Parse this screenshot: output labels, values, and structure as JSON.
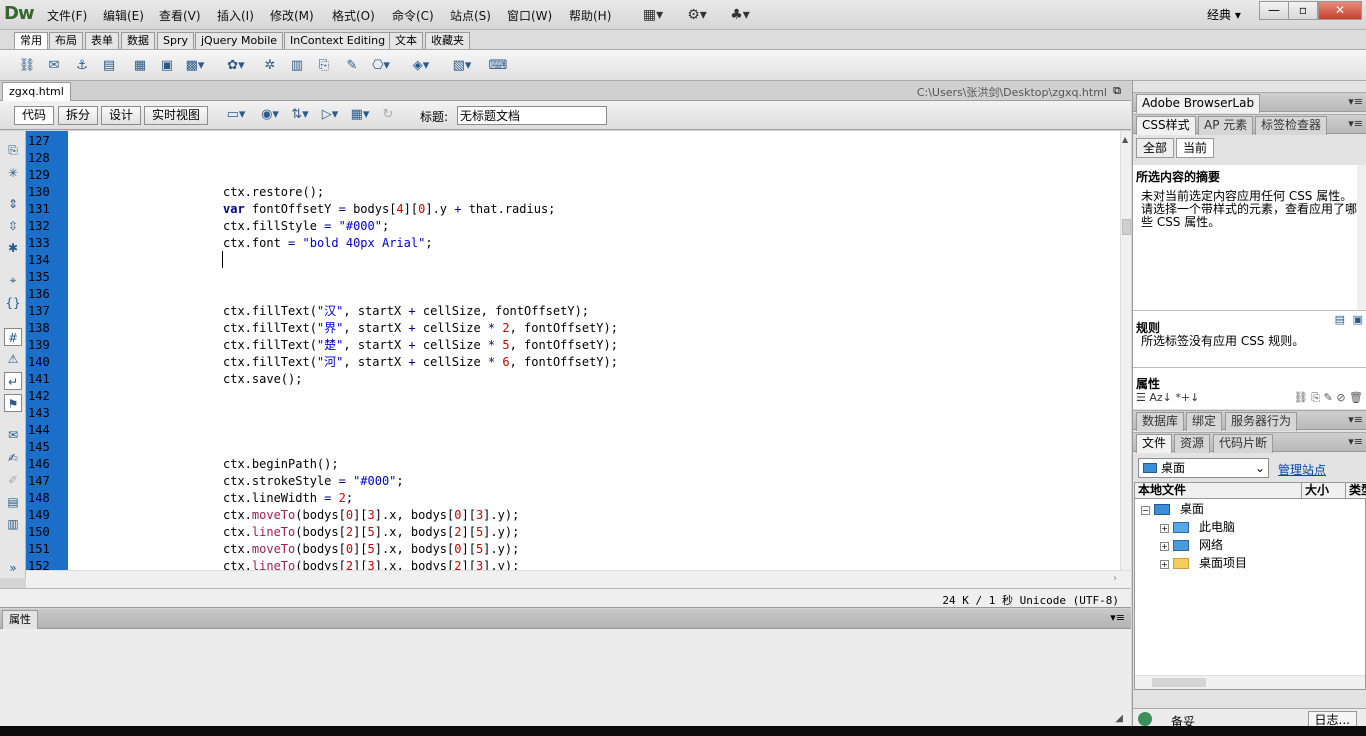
{
  "app": {
    "logo": "Dw"
  },
  "menu": [
    "文件(F)",
    "编辑(E)",
    "查看(V)",
    "插入(I)",
    "修改(M)",
    "格式(O)",
    "命令(C)",
    "站点(S)",
    "窗口(W)",
    "帮助(H)"
  ],
  "workspace": {
    "label": "经典",
    "arrow": "▾"
  },
  "window": {
    "min": "—",
    "max": "▫",
    "close": "✕"
  },
  "insert_tabs": [
    "常用",
    "布局",
    "表单",
    "数据",
    "Spry",
    "jQuery Mobile",
    "InContext Editing",
    "文本",
    "收藏夹"
  ],
  "document": {
    "filename": "zgxq.html",
    "path": "C:\\Users\\张洪剑\\Desktop\\zgxq.html",
    "view_buttons": [
      "代码",
      "拆分",
      "设计",
      "实时视图"
    ],
    "title_label": "标题:",
    "title_value": "无标题文档"
  },
  "code": {
    "lines": [
      {
        "n": "127",
        "t": ""
      },
      {
        "n": "128",
        "t": ""
      },
      {
        "n": "129",
        "t": ""
      },
      {
        "n": "130",
        "t": "ctx.restore();"
      },
      {
        "n": "131",
        "t": "var fontOffsetY = bodys[4][0].y + that.radius;"
      },
      {
        "n": "132",
        "t": "ctx.fillStyle = \"#000\";"
      },
      {
        "n": "133",
        "t": "ctx.font = \"bold 40px Arial\";"
      },
      {
        "n": "134",
        "t": ""
      },
      {
        "n": "135",
        "t": ""
      },
      {
        "n": "136",
        "t": ""
      },
      {
        "n": "137",
        "t": "ctx.fillText(\"汉\", startX + cellSize, fontOffsetY);"
      },
      {
        "n": "138",
        "t": "ctx.fillText(\"界\", startX + cellSize * 2, fontOffsetY);"
      },
      {
        "n": "139",
        "t": "ctx.fillText(\"楚\", startX + cellSize * 5, fontOffsetY);"
      },
      {
        "n": "140",
        "t": "ctx.fillText(\"河\", startX + cellSize * 6, fontOffsetY);"
      },
      {
        "n": "141",
        "t": "ctx.save();"
      },
      {
        "n": "142",
        "t": ""
      },
      {
        "n": "143",
        "t": ""
      },
      {
        "n": "144",
        "t": ""
      },
      {
        "n": "145",
        "t": ""
      },
      {
        "n": "146",
        "t": "ctx.beginPath();"
      },
      {
        "n": "147",
        "t": "ctx.strokeStyle = \"#000\";"
      },
      {
        "n": "148",
        "t": "ctx.lineWidth = 2;"
      },
      {
        "n": "149",
        "t": "ctx.moveTo(bodys[0][3].x, bodys[0][3].y);"
      },
      {
        "n": "150",
        "t": "ctx.lineTo(bodys[2][5].x, bodys[2][5].y);"
      },
      {
        "n": "151",
        "t": "ctx.moveTo(bodys[0][5].x, bodys[0][5].y);"
      },
      {
        "n": "152",
        "t": "ctx.lineTo(bodys[2][3].x, bodys[2][3].y);"
      }
    ]
  },
  "status": {
    "text": "24 K / 1 秒  Unicode (UTF-8)"
  },
  "properties_panel": {
    "tab": "属性"
  },
  "right": {
    "browserlab": "Adobe BrowserLab",
    "css_tabs": [
      "CSS样式",
      "AP 元素",
      "标签检查器"
    ],
    "css_modes": [
      "全部",
      "当前"
    ],
    "summary_title": "所选内容的摘要",
    "summary_text": "未对当前选定内容应用任何 CSS 属性。请选择一个带样式的元素，查看应用了哪些 CSS 属性。",
    "rules_title": "规则",
    "rules_text": "所选标签没有应用 CSS 规则。",
    "props_title": "属性",
    "db_tabs": [
      "数据库",
      "绑定",
      "服务器行为"
    ],
    "file_tabs": [
      "文件",
      "资源",
      "代码片断"
    ],
    "site_select": "桌面",
    "manage_link": "管理站点",
    "cols": [
      "本地文件",
      "大小",
      "类型"
    ],
    "tree": [
      {
        "label": "桌面",
        "sign": "⊟",
        "level": 0
      },
      {
        "label": "此电脑",
        "sign": "⊞",
        "level": 1
      },
      {
        "label": "网络",
        "sign": "⊞",
        "level": 1
      },
      {
        "label": "桌面项目",
        "sign": "⊞",
        "level": 1
      }
    ],
    "log_status": "备妥",
    "log_button": "日志..."
  },
  "colors": {
    "gutter": "#1b6fc9",
    "keyword": "#00008b",
    "string": "#0000cd",
    "number": "#cc0000",
    "method": "#a02050",
    "link": "#0645ad"
  }
}
